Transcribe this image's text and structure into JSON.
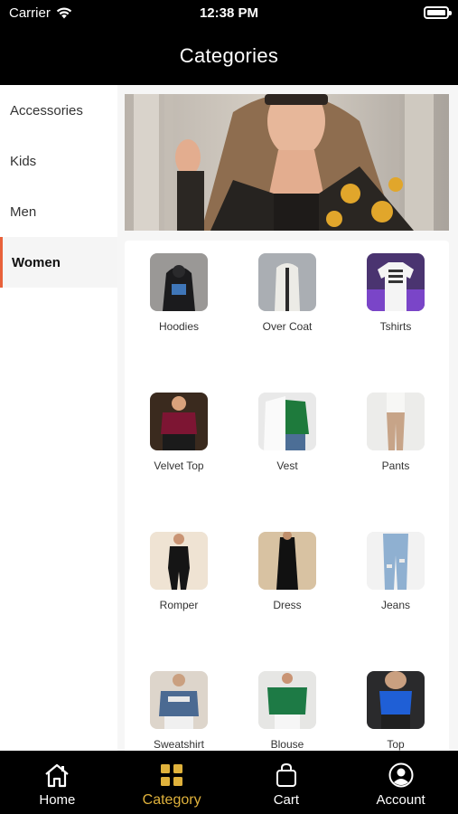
{
  "status_bar": {
    "carrier": "Carrier",
    "time": "12:38 PM"
  },
  "header": {
    "title": "Categories"
  },
  "sidebar": {
    "items": [
      {
        "label": "Accessories",
        "active": false
      },
      {
        "label": "Kids",
        "active": false
      },
      {
        "label": "Men",
        "active": false
      },
      {
        "label": "Women",
        "active": true
      }
    ]
  },
  "colors": {
    "accent": "#e0b23c",
    "active_marker": "#e8613a",
    "bar_bg": "#000000"
  },
  "categories": [
    {
      "label": "Hoodies",
      "icon": "hoodie-photo"
    },
    {
      "label": "Over Coat",
      "icon": "overcoat-photo"
    },
    {
      "label": "Tshirts",
      "icon": "tshirt-photo"
    },
    {
      "label": "Velvet Top",
      "icon": "velvet-top-photo"
    },
    {
      "label": "Vest",
      "icon": "vest-photo"
    },
    {
      "label": "Pants",
      "icon": "pants-photo"
    },
    {
      "label": "Romper",
      "icon": "romper-photo"
    },
    {
      "label": "Dress",
      "icon": "dress-photo"
    },
    {
      "label": "Jeans",
      "icon": "jeans-photo"
    },
    {
      "label": "Sweatshirt",
      "icon": "sweatshirt-photo"
    },
    {
      "label": "Blouse",
      "icon": "blouse-photo"
    },
    {
      "label": "Top",
      "icon": "top-photo"
    }
  ],
  "tabbar": {
    "items": [
      {
        "label": "Home",
        "icon": "home-icon",
        "active": false
      },
      {
        "label": "Category",
        "icon": "grid-icon",
        "active": true
      },
      {
        "label": "Cart",
        "icon": "bag-icon",
        "active": false
      },
      {
        "label": "Account",
        "icon": "user-icon",
        "active": false
      }
    ]
  }
}
